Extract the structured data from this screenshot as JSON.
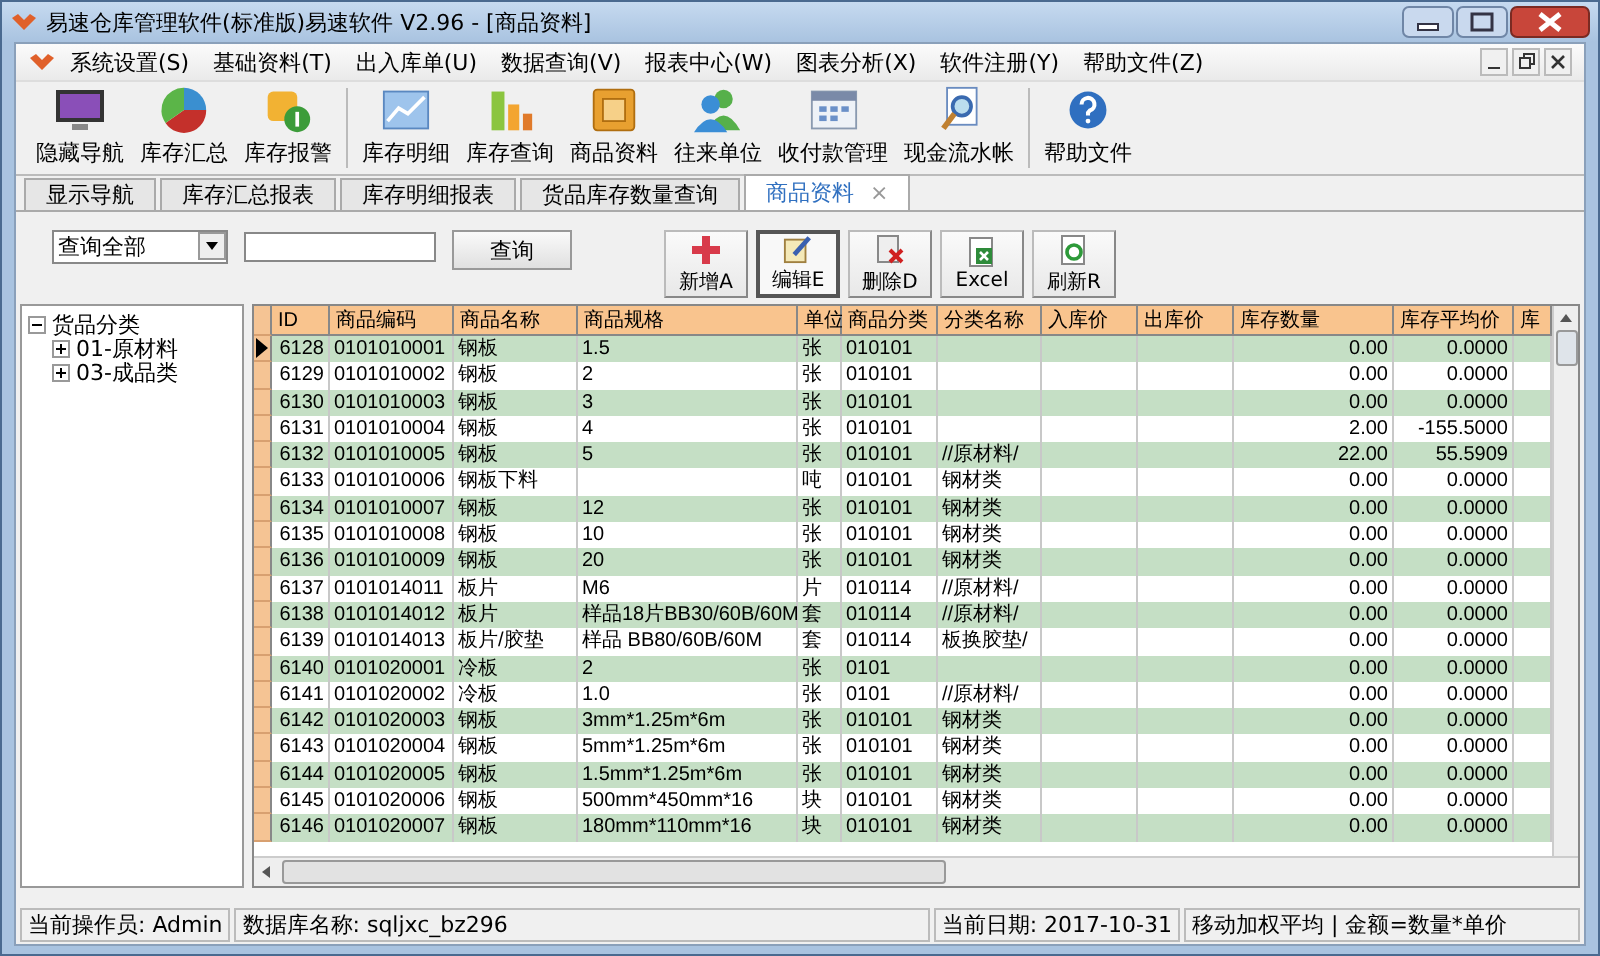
{
  "window": {
    "title": "易速仓库管理软件(标准版)易速软件 V2.96 - [商品资料]"
  },
  "menu": [
    "系统设置(S)",
    "基础资料(T)",
    "出入库单(U)",
    "数据查询(V)",
    "报表中心(W)",
    "图表分析(X)",
    "软件注册(Y)",
    "帮助文件(Z)"
  ],
  "toolbar": [
    {
      "label": "隐藏导航",
      "kind": "monitor"
    },
    {
      "label": "库存汇总",
      "kind": "pie"
    },
    {
      "label": "库存报警",
      "kind": "alert"
    },
    {
      "label": "库存明细",
      "kind": "chart"
    },
    {
      "label": "库存查询",
      "kind": "bars"
    },
    {
      "label": "商品资料",
      "kind": "box"
    },
    {
      "label": "往来单位",
      "kind": "people"
    },
    {
      "label": "收付款管理",
      "kind": "calendar"
    },
    {
      "label": "现金流水帐",
      "kind": "search"
    },
    {
      "label": "帮助文件",
      "kind": "help"
    }
  ],
  "tabs": [
    {
      "label": "显示导航",
      "selected": false
    },
    {
      "label": "库存汇总报表",
      "selected": false
    },
    {
      "label": "库存明细报表",
      "selected": false
    },
    {
      "label": "货品库存数量查询",
      "selected": false
    },
    {
      "label": "商品资料",
      "selected": true,
      "close": "×"
    }
  ],
  "query": {
    "dropdown": "查询全部",
    "button": "查询"
  },
  "actions": [
    {
      "label": "新增A",
      "kind": "add",
      "pressed": false
    },
    {
      "label": "编辑E",
      "kind": "edit",
      "pressed": true
    },
    {
      "label": "删除D",
      "kind": "delete",
      "pressed": false
    },
    {
      "label": "Excel",
      "kind": "excel",
      "pressed": false
    },
    {
      "label": "刷新R",
      "kind": "refresh",
      "pressed": false
    }
  ],
  "tree": {
    "label": "货品分类",
    "expanded": true,
    "children": [
      {
        "label": "01-原材料",
        "expanded": false
      },
      {
        "label": "03-成品类",
        "expanded": false
      }
    ]
  },
  "table": {
    "columns": [
      "ID",
      "商品编码",
      "商品名称",
      "商品规格",
      "单位",
      "商品分类",
      "分类名称",
      "入库价",
      "出库价",
      "库存数量",
      "库存平均价",
      "库"
    ],
    "rows": [
      {
        "current": true,
        "id": "6128",
        "code": "0101010001",
        "name": "钢板",
        "spec": "1.5",
        "unit": "张",
        "category": "010101",
        "qty": "0.00",
        "avg": "0.0000"
      },
      {
        "current": false,
        "id": "6129",
        "code": "0101010002",
        "name": "钢板",
        "spec": "2",
        "unit": "张",
        "category": "010101",
        "qty": "0.00",
        "avg": "0.0000"
      },
      {
        "current": false,
        "id": "6130",
        "code": "0101010003",
        "name": "钢板",
        "spec": "3",
        "unit": "张",
        "category": "010101",
        "qty": "0.00",
        "avg": "0.0000"
      },
      {
        "current": false,
        "id": "6131",
        "code": "0101010004",
        "name": "钢板",
        "spec": "4",
        "unit": "张",
        "category": "010101",
        "qty": "2.00",
        "avg": "-155.5000"
      },
      {
        "current": false,
        "id": "6132",
        "code": "0101010005",
        "name": "钢板",
        "spec": "5",
        "unit": "张",
        "category": "010101",
        "category_name": "//原材料/",
        "qty": "22.00",
        "avg": "55.5909"
      },
      {
        "current": false,
        "id": "6133",
        "code": "0101010006",
        "name": "钢板下料",
        "unit": "吨",
        "category": "010101",
        "category_name": "钢材类",
        "qty": "0.00",
        "avg": "0.0000"
      },
      {
        "current": false,
        "id": "6134",
        "code": "0101010007",
        "name": "钢板",
        "spec": "12",
        "unit": "张",
        "category": "010101",
        "category_name": "钢材类",
        "qty": "0.00",
        "avg": "0.0000"
      },
      {
        "current": false,
        "id": "6135",
        "code": "0101010008",
        "name": "钢板",
        "spec": "10",
        "unit": "张",
        "category": "010101",
        "category_name": "钢材类",
        "qty": "0.00",
        "avg": "0.0000"
      },
      {
        "current": false,
        "id": "6136",
        "code": "0101010009",
        "name": "钢板",
        "spec": "20",
        "unit": "张",
        "category": "010101",
        "category_name": "钢材类",
        "qty": "0.00",
        "avg": "0.0000"
      },
      {
        "current": false,
        "id": "6137",
        "code": "0101014011",
        "name": "板片",
        "spec": "M6",
        "unit": "片",
        "category": "010114",
        "category_name": "//原材料/",
        "qty": "0.00",
        "avg": "0.0000"
      },
      {
        "current": false,
        "id": "6138",
        "code": "0101014012",
        "name": "板片",
        "spec": "样品18片BB30/60B/60M",
        "unit": "套",
        "category": "010114",
        "category_name": "//原材料/",
        "qty": "0.00",
        "avg": "0.0000"
      },
      {
        "current": false,
        "id": "6139",
        "code": "0101014013",
        "name": "板片/胶垫",
        "spec": "样品 BB80/60B/60M",
        "unit": "套",
        "category": "010114",
        "category_name": "板换胶垫/",
        "qty": "0.00",
        "avg": "0.0000"
      },
      {
        "current": false,
        "id": "6140",
        "code": "0101020001",
        "name": "冷板",
        "spec": "2",
        "unit": "张",
        "category": "0101",
        "qty": "0.00",
        "avg": "0.0000"
      },
      {
        "current": false,
        "id": "6141",
        "code": "0101020002",
        "name": "冷板",
        "spec": "1.0",
        "unit": "张",
        "category": "0101",
        "category_name": "//原材料/",
        "qty": "0.00",
        "avg": "0.0000"
      },
      {
        "current": false,
        "id": "6142",
        "code": "0101020003",
        "name": "钢板",
        "spec": "3mm*1.25m*6m",
        "unit": "张",
        "category": "010101",
        "category_name": "钢材类",
        "qty": "0.00",
        "avg": "0.0000"
      },
      {
        "current": false,
        "id": "6143",
        "code": "0101020004",
        "name": "钢板",
        "spec": "5mm*1.25m*6m",
        "unit": "张",
        "category": "010101",
        "category_name": "钢材类",
        "qty": "0.00",
        "avg": "0.0000"
      },
      {
        "current": false,
        "id": "6144",
        "code": "0101020005",
        "name": "钢板",
        "spec": "1.5mm*1.25m*6m",
        "unit": "张",
        "category": "010101",
        "category_name": "钢材类",
        "qty": "0.00",
        "avg": "0.0000"
      },
      {
        "current": false,
        "id": "6145",
        "code": "0101020006",
        "name": "钢板",
        "spec": "500mm*450mm*16",
        "unit": "块",
        "category": "010101",
        "category_name": "钢材类",
        "qty": "0.00",
        "avg": "0.0000"
      },
      {
        "current": false,
        "id": "6146",
        "code": "0101020007",
        "name": "钢板",
        "spec": "180mm*110mm*16",
        "unit": "块",
        "category": "010101",
        "category_name": "钢材类",
        "qty": "0.00",
        "avg": "0.0000"
      }
    ]
  },
  "status_bar": [
    "当前操作员: Admin",
    "数据库名称: sqljxc_bz296",
    "当前日期: 2017-10-31",
    "移动加权平均 | 金额=数量*单价"
  ]
}
